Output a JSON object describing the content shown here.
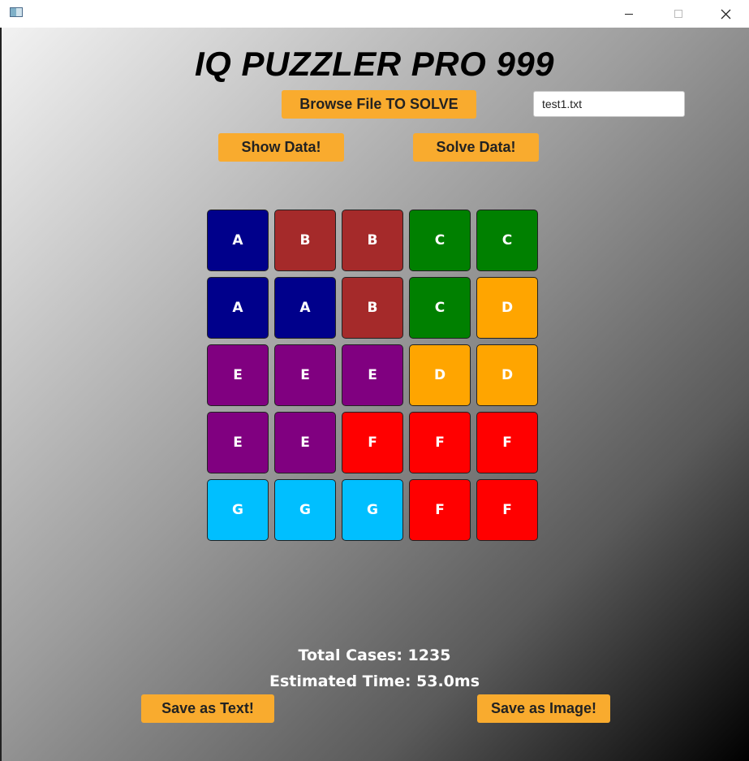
{
  "window": {
    "controls": {
      "minimize_icon": "minimize-icon",
      "maximize_icon": "maximize-icon",
      "close_icon": "close-icon"
    }
  },
  "header": {
    "title": "IQ PUZZLER PRO 999"
  },
  "toolbar": {
    "browse_label": "Browse File TO SOLVE",
    "file_value": "test1.txt",
    "show_label": "Show Data!",
    "solve_label": "Solve Data!"
  },
  "board": {
    "rows": 5,
    "cols": 5,
    "cells": [
      [
        "A",
        "B",
        "B",
        "C",
        "C"
      ],
      [
        "A",
        "A",
        "B",
        "C",
        "D"
      ],
      [
        "E",
        "E",
        "E",
        "D",
        "D"
      ],
      [
        "E",
        "E",
        "F",
        "F",
        "F"
      ],
      [
        "G",
        "G",
        "G",
        "F",
        "F"
      ]
    ],
    "colors": {
      "A": "#00008b",
      "B": "#a52a2a",
      "C": "#008000",
      "D": "#ffa500",
      "E": "#800080",
      "F": "#ff0000",
      "G": "#00bfff"
    }
  },
  "stats": {
    "total_cases": "Total Cases: 1235",
    "estimated_time": "Estimated Time: 53.0ms"
  },
  "footer": {
    "save_text_label": "Save as Text!",
    "save_image_label": "Save as Image!"
  },
  "accent_color": "#f9ab2e"
}
